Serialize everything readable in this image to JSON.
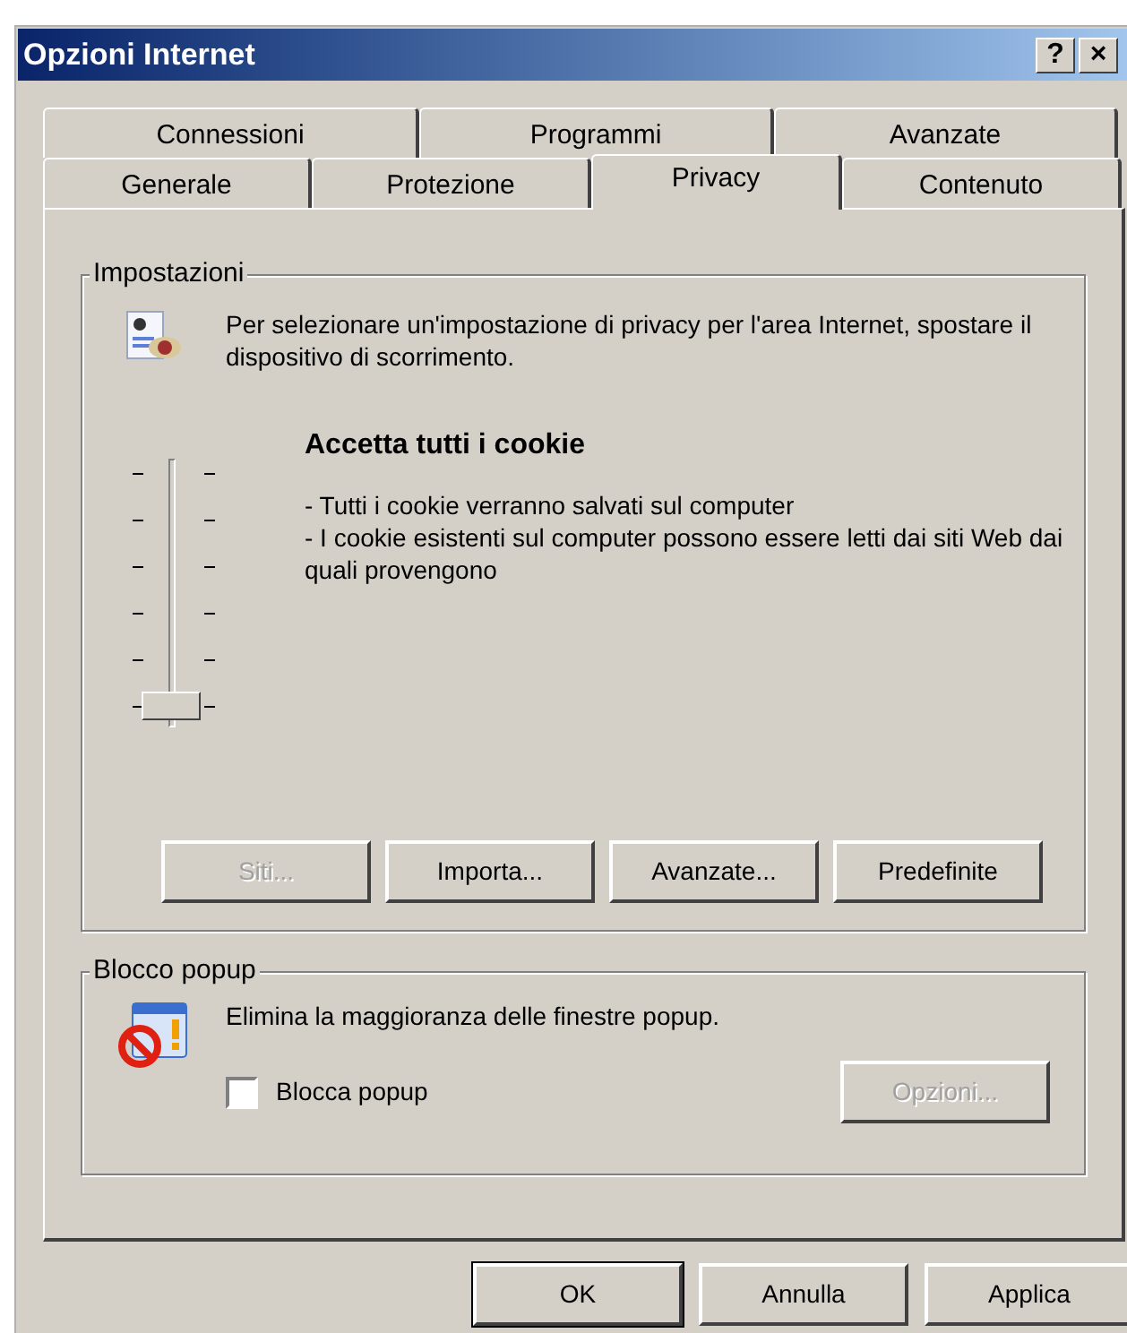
{
  "window": {
    "title": "Opzioni Internet",
    "title_buttons": [
      "?",
      "×"
    ]
  },
  "tab_rows": [
    [
      {
        "label": "Connessioni",
        "selected": false
      },
      {
        "label": "Programmi",
        "selected": false
      },
      {
        "label": "Avanzate",
        "selected": false
      }
    ],
    [
      {
        "label": "Generale",
        "selected": false
      },
      {
        "label": "Protezione",
        "selected": false
      },
      {
        "label": "Privacy",
        "selected": true
      },
      {
        "label": "Contenuto",
        "selected": false
      }
    ]
  ],
  "settings_group": {
    "title": "Impostazioni",
    "intro": "Per selezionare un'impostazione di privacy per l'area Internet, spostare il dispositivo di scorrimento.",
    "slider": {
      "level": 0
    },
    "level_title": "Accetta tutti i cookie",
    "level_lines": [
      "- Tutti i cookie verranno salvati sul computer",
      "- I cookie esistenti sul computer possono essere letti dai siti Web dai quali provengono"
    ],
    "buttons": [
      {
        "label": "Siti...",
        "disabled": true
      },
      {
        "label": "Importa...",
        "disabled": false
      },
      {
        "label": "Avanzate...",
        "disabled": false
      },
      {
        "label": "Predefinite",
        "disabled": false
      }
    ]
  },
  "popup_group": {
    "title": "Blocco popup",
    "text": "Elimina la maggioranza delle finestre popup.",
    "checkbox": {
      "label": "Blocca popup",
      "checked": false
    },
    "button": {
      "label": "Opzioni...",
      "disabled": true
    }
  },
  "footer_buttons": [
    {
      "label": "OK",
      "default": true
    },
    {
      "label": "Annulla",
      "default": false
    },
    {
      "label": "Applica",
      "default": false
    }
  ]
}
